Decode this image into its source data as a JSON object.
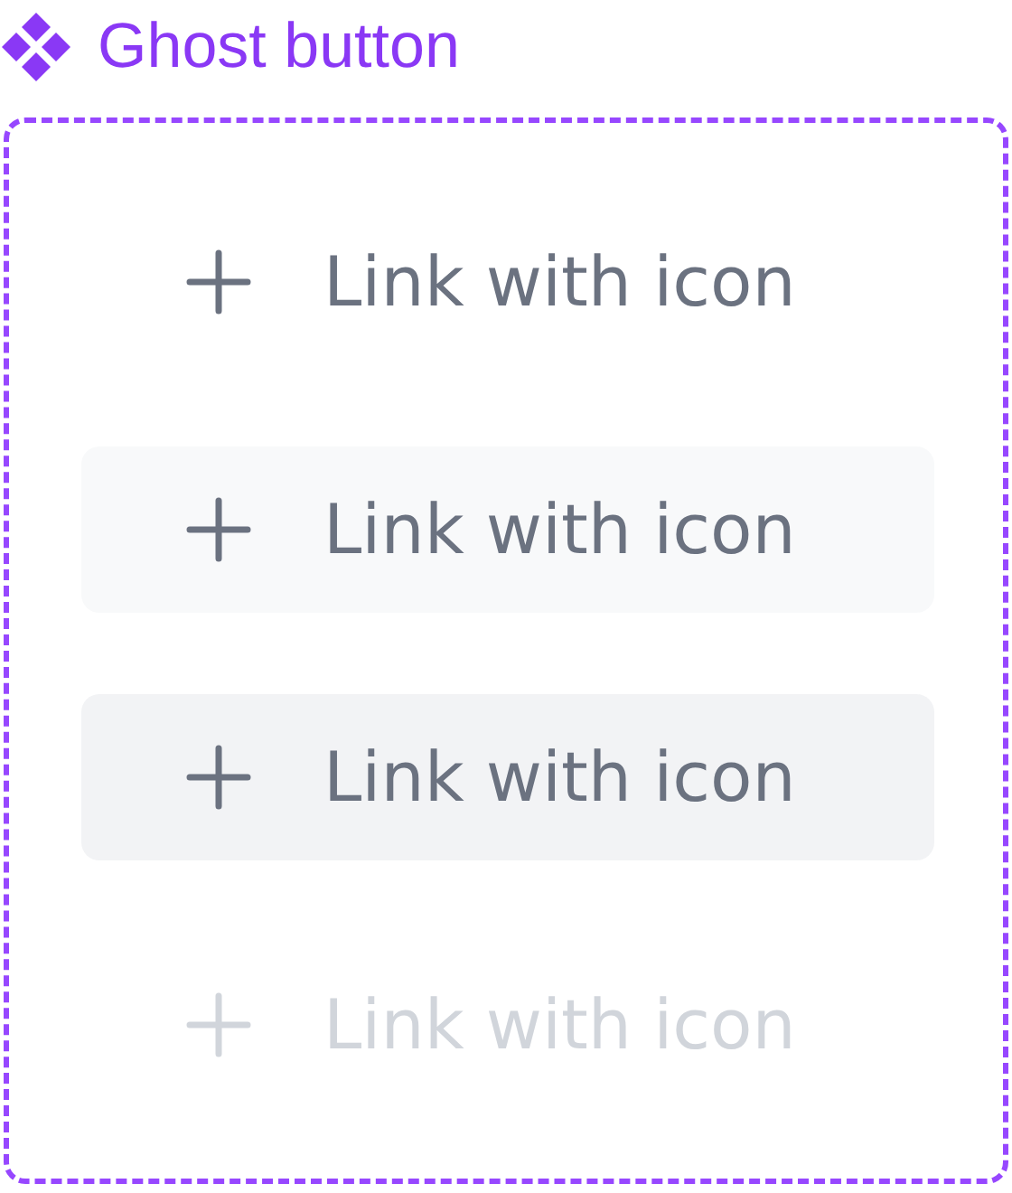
{
  "component_set": {
    "title": "Ghost button"
  },
  "buttons": [
    {
      "label": "Link with icon",
      "kind": "default"
    },
    {
      "label": "Link with icon",
      "kind": "hover"
    },
    {
      "label": "Link with icon",
      "kind": "pressed"
    },
    {
      "label": "Link with icon",
      "kind": "disabled"
    }
  ]
}
